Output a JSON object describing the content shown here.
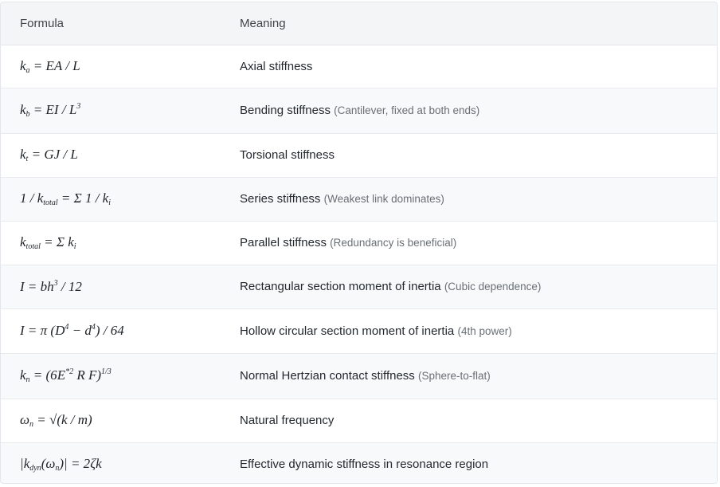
{
  "headers": {
    "formula": "Formula",
    "meaning": "Meaning"
  },
  "rows": [
    {
      "formula": "<i>k<sub>a</sub></i> = <i>EA</i> / <i>L</i>",
      "meaning": "Axial stiffness",
      "note": ""
    },
    {
      "formula": "<i>k<sub>b</sub></i> = <i>EI</i> / <i>L</i><sup>3</sup>",
      "meaning": "Bending stiffness",
      "note": "(Cantilever, fixed at both ends)"
    },
    {
      "formula": "<i>k<sub>t</sub></i> = <i>GJ</i> / <i>L</i>",
      "meaning": "Torsional stiffness",
      "note": ""
    },
    {
      "formula": "1 / <i>k<sub>total</sub></i> = Σ 1 / <i>k<sub>i</sub></i>",
      "meaning": "Series stiffness",
      "note": "(Weakest link dominates)"
    },
    {
      "formula": "<i>k<sub>total</sub></i> = Σ <i>k<sub>i</sub></i>",
      "meaning": "Parallel stiffness",
      "note": "(Redundancy is beneficial)"
    },
    {
      "formula": "<i>I</i> = <i>bh</i><sup>3</sup> / 12",
      "meaning": "Rectangular section moment of inertia",
      "note": "(Cubic dependence)"
    },
    {
      "formula": "<i>I</i> = π (<i>D</i><sup>4</sup> − <i>d</i><sup>4</sup>) / 64",
      "meaning": "Hollow circular section moment of inertia",
      "note": "(4th power)"
    },
    {
      "formula": "<i>k<sub>n</sub></i> = (6<i>E</i><sup>*2</sup> <i>R F</i>)<sup>1/3</sup>",
      "meaning": "Normal Hertzian contact stiffness",
      "note": "(Sphere-to-flat)"
    },
    {
      "formula": "<i>ω<sub>n</sub></i> = √(<i>k</i> / <i>m</i>)",
      "meaning": "Natural frequency",
      "note": ""
    },
    {
      "formula": "|<i>k<sub>dyn</sub></i>(<i>ω<sub>n</sub></i>)| = 2<i>ζk</i>",
      "meaning": "Effective dynamic stiffness in resonance region",
      "note": ""
    }
  ]
}
